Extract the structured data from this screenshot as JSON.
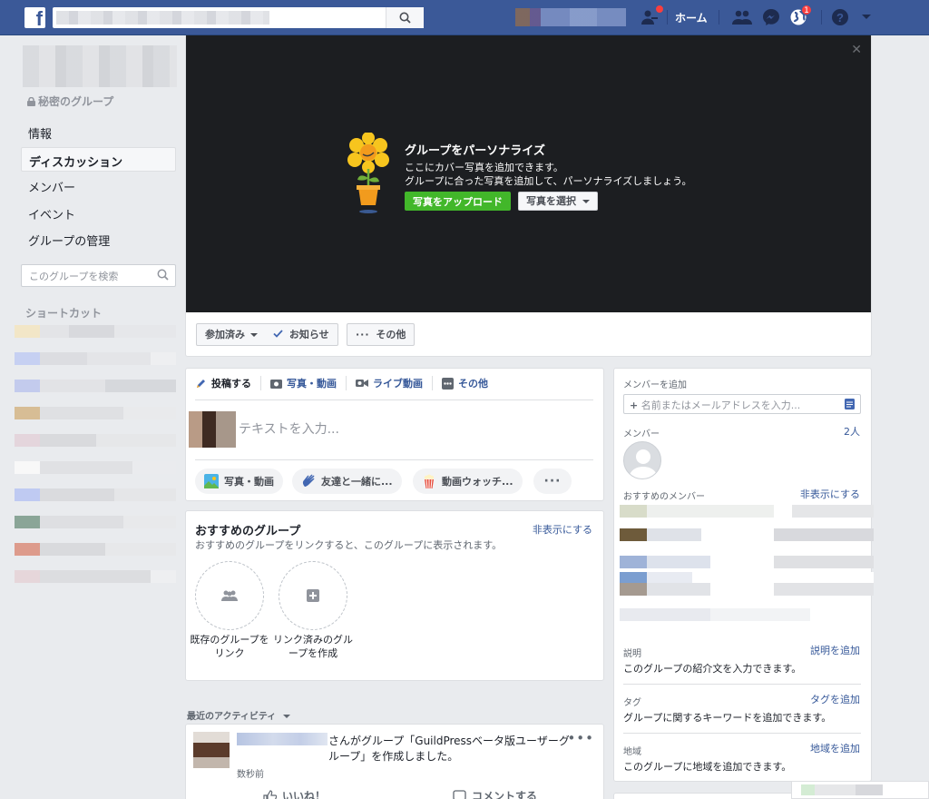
{
  "topbar": {
    "home_label": "ホーム",
    "notifications_count": "1"
  },
  "sidebar": {
    "privacy_label": "秘密のグループ",
    "nav": [
      {
        "label": "情報"
      },
      {
        "label": "ディスカッション"
      },
      {
        "label": "メンバー"
      },
      {
        "label": "イベント"
      },
      {
        "label": "グループの管理"
      }
    ],
    "search_placeholder": "このグループを検索",
    "shortcuts_label": "ショートカット"
  },
  "cover": {
    "title": "グループをパーソナライズ",
    "desc_line1": "ここにカバー写真を追加できます。",
    "desc_line2": "グループに合った写真を追加して、パーソナライズしましょう。",
    "upload_button": "写真をアップロード",
    "select_button": "写真を選択"
  },
  "group_actions": {
    "joined": "参加済み",
    "notifications": "お知らせ",
    "more": "その他"
  },
  "composer": {
    "tabs": [
      "投稿する",
      "写真・動画",
      "ライブ動画",
      "その他"
    ],
    "placeholder": "テキストを入力...",
    "actions": [
      "写真・動画",
      "友達と一緒に...",
      "動画ウォッチ..."
    ]
  },
  "suggested_groups": {
    "title": "おすすめのグループ",
    "hide": "非表示にする",
    "desc": "おすすめのグループをリンクすると、このグループに表示されます。",
    "link_existing": "既存のグループをリンク",
    "create_linked": "リンク済みのグループを作成"
  },
  "activity": {
    "label": "最近のアクティビティ",
    "text": "さんがグループ「GuildPressベータ版ユーザーグループ」を作成しました。",
    "time": "数秒前",
    "like": "いいね！",
    "comment": "コメントする"
  },
  "right_column": {
    "add_member_title": "メンバーを追加",
    "add_member_placeholder": "名前またはメールアドレスを入力...",
    "members_label": "メンバー",
    "members_count": "2人",
    "recommended_label": "おすすめのメンバー",
    "recommended_hide": "非表示にする",
    "about_label": "説明",
    "about_add": "説明を追加",
    "about_text": "このグループの紹介文を入力できます。",
    "tags_label": "タグ",
    "tags_add": "タグを追加",
    "tags_text": "グループに関するキーワードを追加できます。",
    "location_label": "地域",
    "location_add": "地域を追加",
    "location_text": "このグループに地域を追加できます。"
  },
  "colors": {
    "brand": "#3b5998",
    "link": "#365899",
    "green": "#42b72a",
    "background": "#e9ebee"
  }
}
